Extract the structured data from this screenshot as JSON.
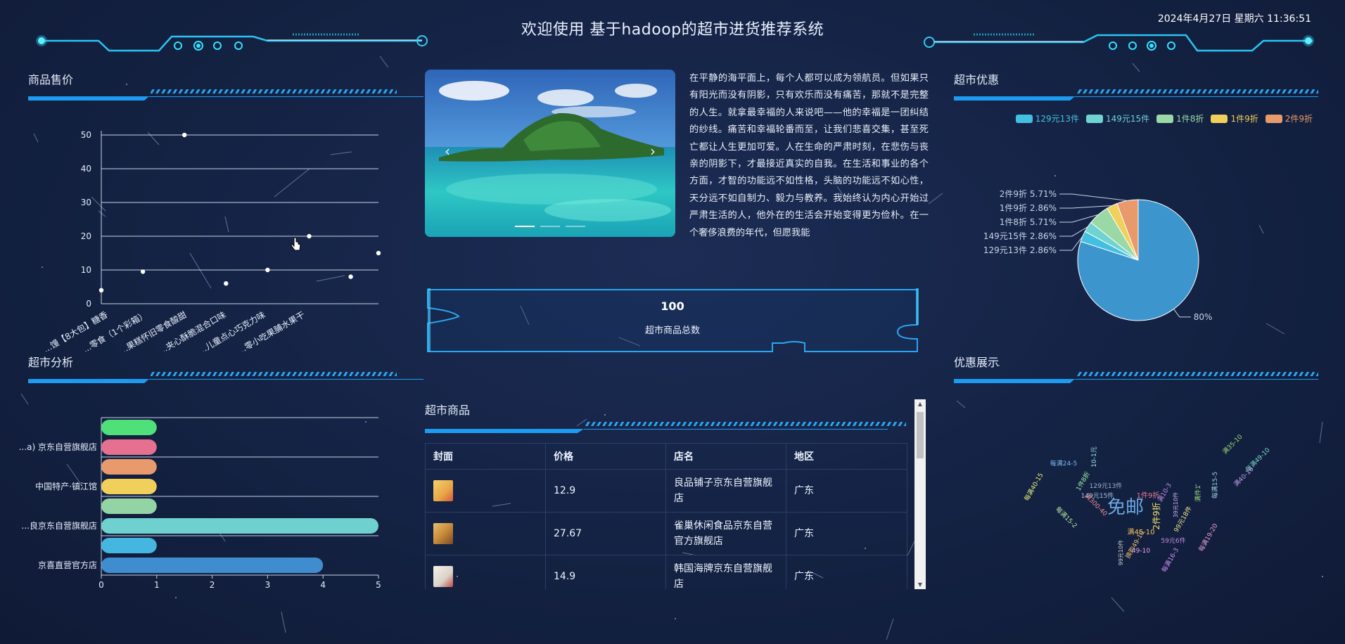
{
  "header": {
    "title": "欢迎使用 基于hadoop的超市进货推荐系统",
    "datetime": "2024年4月27日 星期六 11:36:51"
  },
  "panels": {
    "price": {
      "title": "商品售价"
    },
    "analysis": {
      "title": "超市分析"
    },
    "discount": {
      "title": "超市优惠"
    },
    "promo": {
      "title": "优惠展示"
    },
    "goods": {
      "title": "超市商品"
    }
  },
  "intro_text": "在平静的海平面上，每个人都可以成为领航员。但如果只有阳光而没有阴影，只有欢乐而没有痛苦，那就不是完整的人生。就拿最幸福的人来说吧——他的幸福是一团纠结的纱线。痛苦和幸福轮番而至，让我们悲喜交集，甚至死亡都让人生更加可爱。人在生命的严肃时刻，在悲伤与丧亲的阴影下，才最接近真实的自我。在生活和事业的各个方面，才智的功能远不如性格，头脑的功能远不如心性，天分远不如自制力、毅力与教养。我始终认为内心开始过严肃生活的人，他外在的生活会开始变得更为俭朴。在一个奢侈浪费的年代，但愿我能",
  "carousel": {
    "prev": "‹",
    "next": "›",
    "slide_count": 3,
    "active_slide": 1
  },
  "stat": {
    "value": "100",
    "label": "超市商品总数"
  },
  "chart_data": [
    {
      "type": "line",
      "name": "price-chart",
      "categories": [
        "...馒【8大包】糖香",
        "...零食（1个彩箱）",
        "...果糕怀旧零食酸甜",
        "...夹心酥脆混合口味",
        "...儿童点心巧克力味",
        "...零小吃果脯水果干"
      ],
      "x_positions": [
        0,
        1,
        2,
        3,
        4,
        5,
        6,
        7,
        8,
        9
      ],
      "values": [
        4,
        9.5,
        50,
        6,
        10,
        20,
        8,
        15
      ],
      "point_index": [
        0,
        1.5,
        3,
        4.5,
        6,
        7.5,
        9,
        10
      ],
      "ylim": [
        0,
        50
      ],
      "yticks": [
        0,
        10,
        20,
        30,
        40,
        50
      ],
      "grid": true,
      "show_line": false
    },
    {
      "type": "bar",
      "name": "shop-analysis",
      "orientation": "horizontal",
      "categories": [
        "",
        "...a) 京东自营旗舰店",
        "",
        "中国特产·镇江馆",
        "",
        "...良京东自营旗舰店",
        "",
        "京喜直营官方店"
      ],
      "values": [
        1,
        1,
        1,
        1,
        1,
        5,
        1,
        4
      ],
      "colors": [
        "#4fe07a",
        "#e5708f",
        "#e89a6c",
        "#f0cf5a",
        "#93d4a4",
        "#6fd1cf",
        "#45b6e0",
        "#3f8dcf"
      ],
      "xlim": [
        0,
        5
      ],
      "xticks": [
        0,
        1,
        2,
        3,
        4,
        5
      ]
    },
    {
      "type": "pie",
      "name": "discount-pie",
      "legend": [
        "129元13件",
        "149元15件",
        "1件8折",
        "1件9折",
        "2件9折"
      ],
      "slices": [
        {
          "label": "",
          "value": 80,
          "display": "80%",
          "color": "#3d95cd"
        },
        {
          "label": "129元13件",
          "value": 2.86,
          "display": "129元13件 2.86%",
          "color": "#43bfe0"
        },
        {
          "label": "149元15件",
          "value": 2.86,
          "display": "149元15件 2.86%",
          "color": "#6fd3d2"
        },
        {
          "label": "1件8折",
          "value": 5.71,
          "display": "1件8折 5.71%",
          "color": "#9ad9a5"
        },
        {
          "label": "1件9折",
          "value": 2.86,
          "display": "1件9折 2.86%",
          "color": "#f0cf5a"
        },
        {
          "label": "2件9折",
          "value": 5.71,
          "display": "2件9折 5.71%",
          "color": "#e89a6c"
        }
      ],
      "legend_placement": "top-right"
    }
  ],
  "goods_table": {
    "headers": [
      "封面",
      "价格",
      "店名",
      "地区"
    ],
    "rows": [
      {
        "price": "12.9",
        "shop_line1": "良品铺子京东自营旗舰",
        "shop_line2": "店",
        "region": "广东",
        "thumb_color": "#e9a446"
      },
      {
        "price": "27.67",
        "shop_line1": "雀巢休闲食品京东自营",
        "shop_line2": "官方旗舰店",
        "region": "广东",
        "thumb_color": "#c98b3a"
      },
      {
        "price": "14.9",
        "shop_line1": "韩国海牌京东自营旗舰",
        "shop_line2": "店",
        "region": "广东",
        "thumb_color": "#d9d2c8"
      }
    ]
  },
  "wordcloud": {
    "words": [
      {
        "text": "免邮",
        "color": "#6aa9e0",
        "size": 26
      },
      {
        "text": "2件9折",
        "color": "#f5e36b",
        "size": 12
      },
      {
        "text": "1件9折",
        "color": "#e97a8f",
        "size": 10
      },
      {
        "text": "满45-10",
        "color": "#f7c65d",
        "size": 10
      },
      {
        "text": "满10-3",
        "color": "#c48de0",
        "size": 9
      },
      {
        "text": "每满40-15",
        "color": "#e3ed7a",
        "size": 9
      },
      {
        "text": "每满24-5",
        "color": "#7ab9f0",
        "size": 9
      },
      {
        "text": "满35-10",
        "color": "#9ad975",
        "size": 9
      },
      {
        "text": "每满49-10",
        "color": "#79d9c9",
        "size": 9
      },
      {
        "text": "每满15-2",
        "color": "#b7e6a1",
        "size": 9
      },
      {
        "text": "99元18件",
        "color": "#f0e68c",
        "size": 9
      },
      {
        "text": "49-10",
        "color": "#f0a0f0",
        "size": 9
      },
      {
        "text": "59元6件",
        "color": "#c48de0",
        "size": 9
      },
      {
        "text": "每满19-20",
        "color": "#e9a0d0",
        "size": 9
      },
      {
        "text": "129元13件",
        "color": "#a0b0d0",
        "size": 9
      },
      {
        "text": "149元15件",
        "color": "#a0c0e0",
        "size": 9
      },
      {
        "text": "99元10件",
        "color": "#d0d0d0",
        "size": 8
      },
      {
        "text": "换购49-10",
        "color": "#f0c070",
        "size": 9
      },
      {
        "text": "每满16-3",
        "color": "#d090f0",
        "size": 9
      },
      {
        "text": "10-1元",
        "color": "#a0e0f0",
        "size": 9
      },
      {
        "text": "每满15-5",
        "color": "#a0d0e0",
        "size": 9
      },
      {
        "text": "满40-16",
        "color": "#c0a0f0",
        "size": 9
      },
      {
        "text": "满件1",
        "color": "#9ad975",
        "size": 9
      },
      {
        "text": "39元10件",
        "color": "#d0b0f0",
        "size": 8
      },
      {
        "text": "满300-40",
        "color": "#f09090",
        "size": 9
      },
      {
        "text": "1件8折",
        "color": "#a0f0a0",
        "size": 9
      }
    ]
  },
  "colors": {
    "accent": "#1d9bf0",
    "glow": "#35e0ff",
    "background": "#152446"
  }
}
